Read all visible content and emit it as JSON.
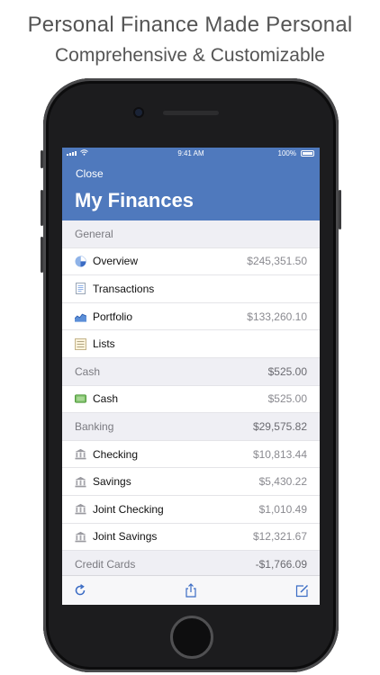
{
  "headline": {
    "title": "Personal Finance Made Personal",
    "subtitle": "Comprehensive & Customizable"
  },
  "status_bar": {
    "time": "9:41 AM",
    "battery": "100%"
  },
  "nav": {
    "close_label": "Close",
    "title": "My Finances"
  },
  "sections": [
    {
      "name": "General",
      "total": "",
      "items": [
        {
          "icon": "pie-chart-icon",
          "label": "Overview",
          "value": "$245,351.50"
        },
        {
          "icon": "document-icon",
          "label": "Transactions",
          "value": ""
        },
        {
          "icon": "area-chart-icon",
          "label": "Portfolio",
          "value": "$133,260.10"
        },
        {
          "icon": "list-icon",
          "label": "Lists",
          "value": ""
        }
      ]
    },
    {
      "name": "Cash",
      "total": "$525.00",
      "items": [
        {
          "icon": "cash-icon",
          "label": "Cash",
          "value": "$525.00"
        }
      ]
    },
    {
      "name": "Banking",
      "total": "$29,575.82",
      "items": [
        {
          "icon": "bank-icon",
          "label": "Checking",
          "value": "$10,813.44"
        },
        {
          "icon": "bank-icon",
          "label": "Savings",
          "value": "$5,430.22"
        },
        {
          "icon": "bank-icon",
          "label": "Joint Checking",
          "value": "$1,010.49"
        },
        {
          "icon": "bank-icon",
          "label": "Joint Savings",
          "value": "$12,321.67"
        }
      ]
    },
    {
      "name": "Credit Cards",
      "total": "-$1,766.09",
      "items": []
    }
  ],
  "toolbar": {
    "items": [
      "refresh-icon",
      "share-icon",
      "compose-icon"
    ]
  },
  "colors": {
    "nav": "#4f79bd",
    "accent": "#3b6cc4",
    "section_bg": "#efeff4"
  }
}
